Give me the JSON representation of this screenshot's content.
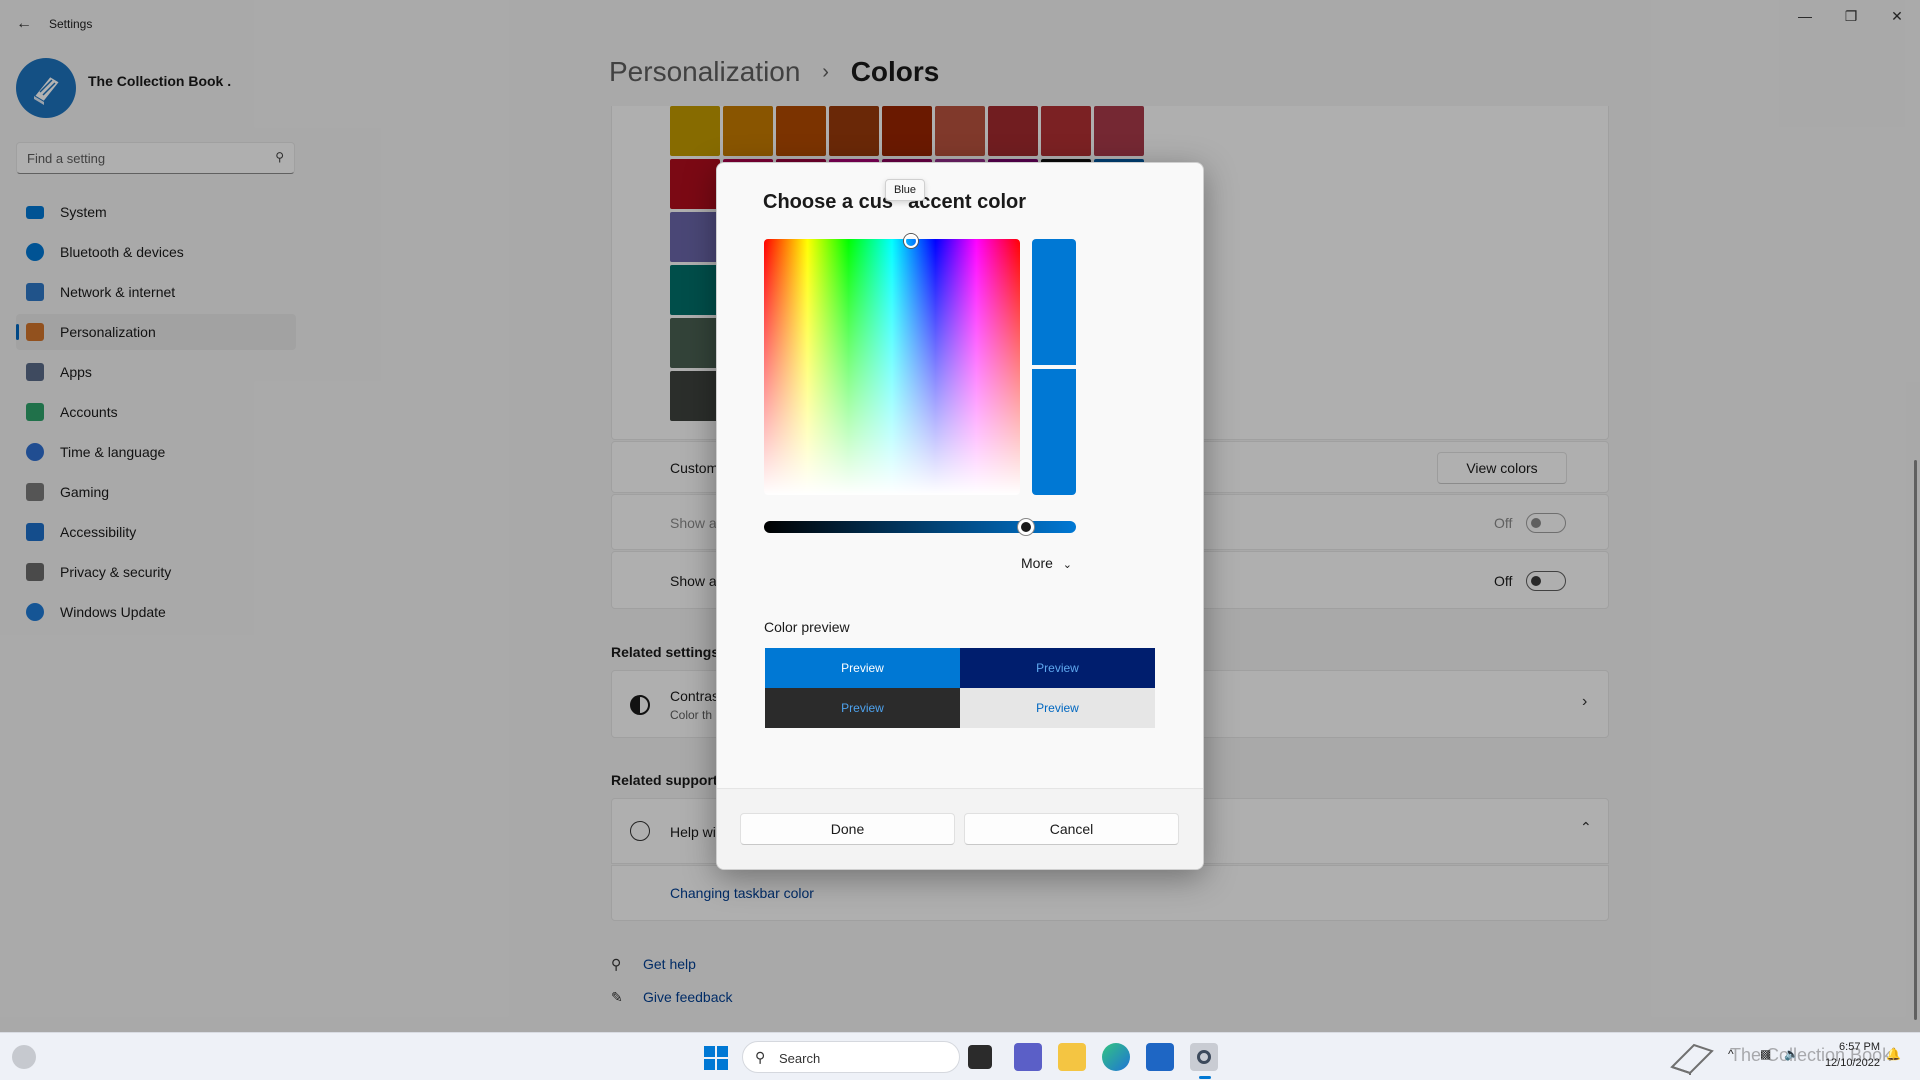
{
  "window": {
    "title": "Settings",
    "back": "←",
    "min": "—",
    "max": "❐",
    "close": "✕"
  },
  "account": {
    "name": "The Collection Book ."
  },
  "search": {
    "placeholder": "Find a setting",
    "icon": "search-icon"
  },
  "nav": [
    {
      "label": "System",
      "icon": "monitor-icon",
      "color": "#0078d4"
    },
    {
      "label": "Bluetooth & devices",
      "icon": "bluetooth-icon",
      "color": "#0078d4"
    },
    {
      "label": "Network & internet",
      "icon": "wifi-icon",
      "color": "#2f78c6"
    },
    {
      "label": "Personalization",
      "icon": "brush-icon",
      "color": "#d1742c",
      "active": true
    },
    {
      "label": "Apps",
      "icon": "apps-icon",
      "color": "#5a6b88"
    },
    {
      "label": "Accounts",
      "icon": "person-icon",
      "color": "#2ea36b"
    },
    {
      "label": "Time & language",
      "icon": "globe-clock-icon",
      "color": "#2f6fd0"
    },
    {
      "label": "Gaming",
      "icon": "controller-icon",
      "color": "#7a7a7a"
    },
    {
      "label": "Accessibility",
      "icon": "accessibility-icon",
      "color": "#1e6fc9"
    },
    {
      "label": "Privacy & security",
      "icon": "shield-icon",
      "color": "#6b6b6b"
    },
    {
      "label": "Windows Update",
      "icon": "sync-icon",
      "color": "#1f7ad6"
    }
  ],
  "breadcrumb": {
    "parent": "Personalization",
    "separator": "›",
    "current": "Colors"
  },
  "palette_colors": [
    [
      "#ffb900",
      "#e74856",
      "#e81123",
      "#ea005e",
      "#c30052",
      "#e3008c",
      "#bf0077",
      "#c239b3",
      "#9a0089",
      "#0078d4"
    ],
    [
      "#ff8c00",
      "#f7630c",
      "#ca5010",
      "#da3b01",
      "#ef6950",
      "#d13438",
      "#ff4343",
      "#e74856",
      "#e81123",
      "#ea005e"
    ]
  ],
  "settings": {
    "custom_colors_label": "Custom",
    "view_colors_button": "View colors",
    "show_accent_start_label": "Show a",
    "show_accent_start_state": "Off",
    "show_accent_title_label": "Show a",
    "show_accent_title_state": "Off"
  },
  "related_settings": {
    "title": "Related settings",
    "contrast_title": "Contras",
    "contrast_sub": "Color th"
  },
  "related_support": {
    "title": "Related support",
    "help_label": "Help wi",
    "link": "Changing taskbar color"
  },
  "footer_links": {
    "get_help": "Get help",
    "feedback": "Give feedback"
  },
  "dialog": {
    "title_left": "Choose a cus",
    "title_right": "accent color",
    "tooltip": "Blue",
    "selected_color": "#0078d4",
    "brightness": 0.84,
    "more_label": "More",
    "more_icon": "chevron-down-icon",
    "preview_title": "Color preview",
    "preview_label": "Preview",
    "done": "Done",
    "cancel": "Cancel"
  },
  "taskbar": {
    "search_label": "Search",
    "time": "6:57 PM",
    "date": "12/10/2022",
    "watermark": "The Collection Book"
  }
}
